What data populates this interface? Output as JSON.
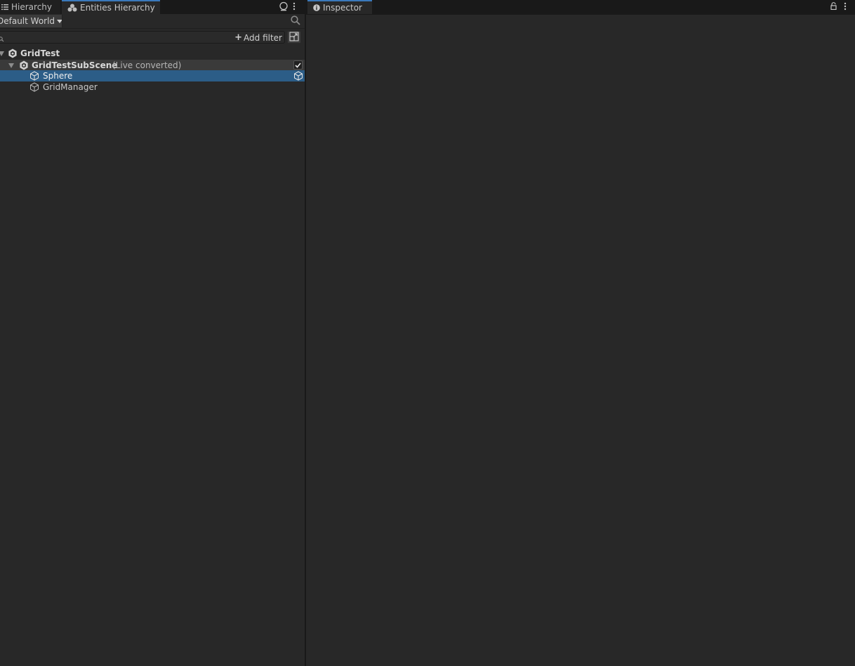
{
  "left_tabs": [
    {
      "label": "Hierarchy",
      "icon": "list-icon"
    },
    {
      "label": "Entities Hierarchy",
      "icon": "entities-icon"
    }
  ],
  "world": {
    "selected": "Default World"
  },
  "search": {
    "value": "",
    "add_filter_label": "Add filter"
  },
  "tree": {
    "scene": {
      "label": "GridTest"
    },
    "subscene": {
      "label": "GridTestSubScene",
      "status": "(Live converted)",
      "enabled": true
    },
    "items": [
      {
        "label": "Sphere",
        "selected": true
      },
      {
        "label": "GridManager",
        "selected": false
      }
    ]
  },
  "inspector": {
    "tab_label": "Inspector"
  },
  "colors": {
    "selection": "#2c5d87",
    "accent": "#3a79bb",
    "panel": "#282828"
  }
}
